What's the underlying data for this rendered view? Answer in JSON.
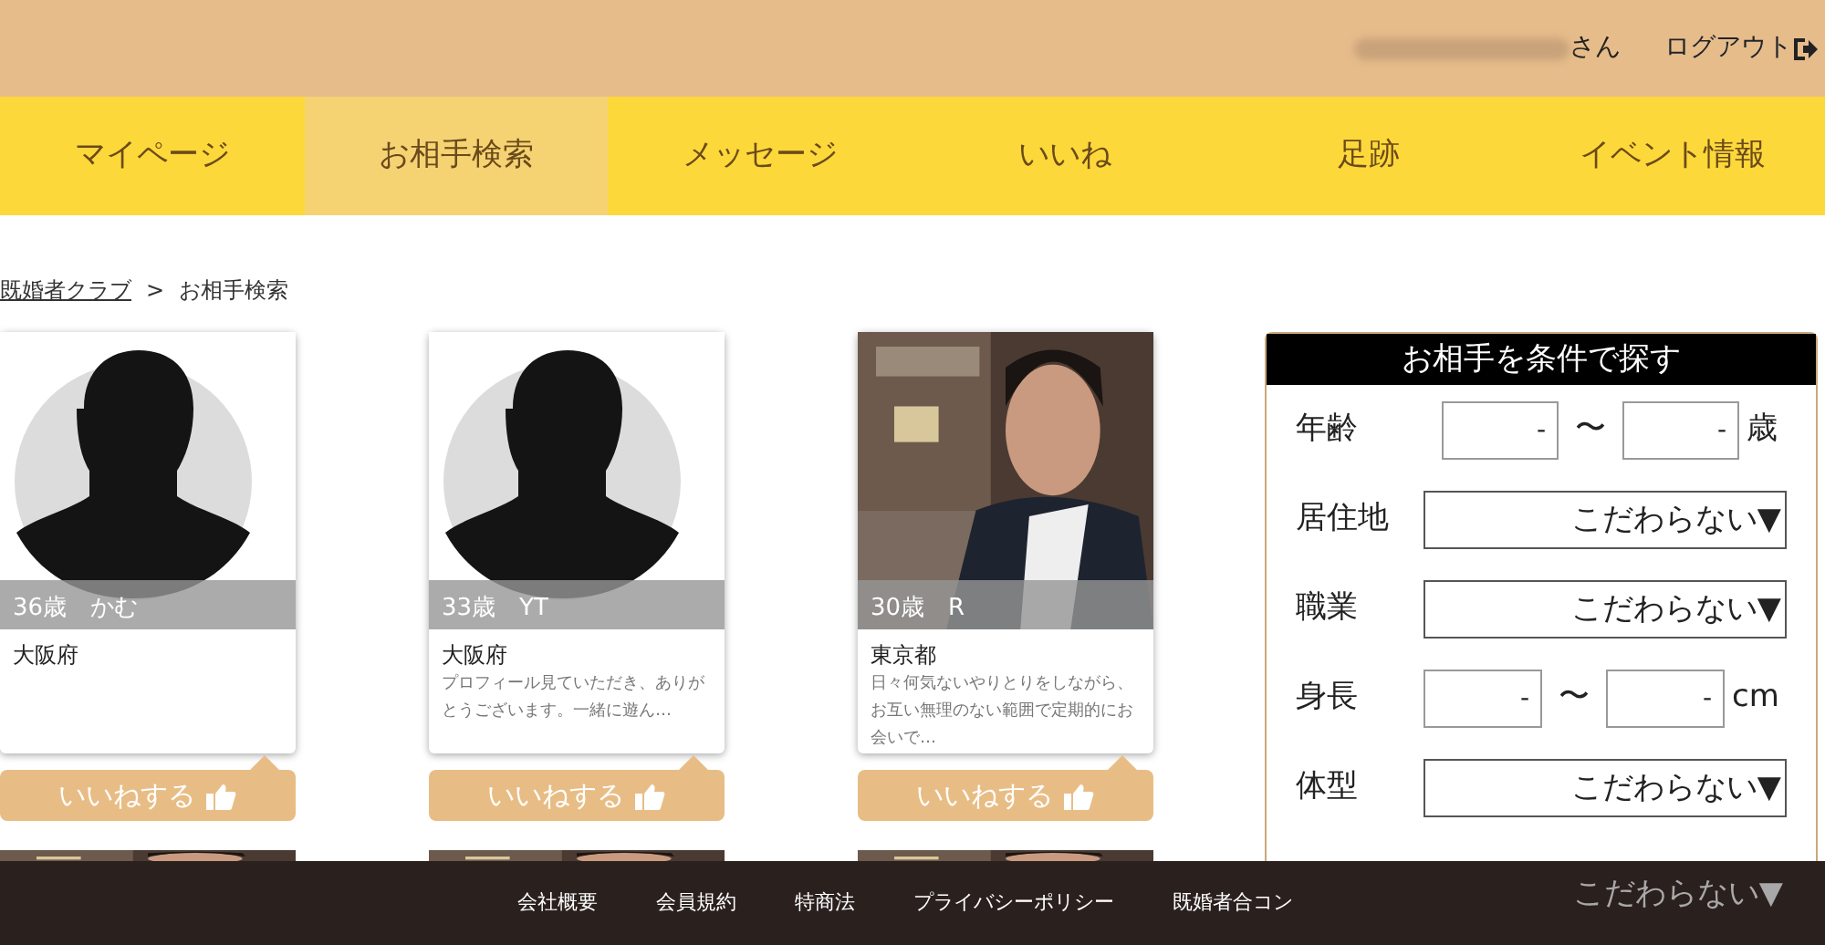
{
  "header": {
    "greeting_suffix": "さん",
    "logout": "ログアウト"
  },
  "nav": [
    {
      "label": "マイページ",
      "selected": false
    },
    {
      "label": "お相手検索",
      "selected": true
    },
    {
      "label": "メッセージ",
      "selected": false
    },
    {
      "label": "いいね",
      "selected": false
    },
    {
      "label": "足跡",
      "selected": false
    },
    {
      "label": "イベント情報",
      "selected": false
    }
  ],
  "breadcrumb": {
    "items": [
      {
        "label": "既婚者クラブ",
        "kind": "link"
      },
      {
        "label": "お相手検索",
        "kind": "current"
      }
    ],
    "separator": ">"
  },
  "cards": [
    {
      "kind": "avatar",
      "caption": "36歳　かむ",
      "location": "大阪府",
      "like": "いいねする"
    },
    {
      "kind": "avatar",
      "caption": "33歳　YT",
      "location": "大阪府",
      "comment": "プロフィール見ていただき、ありがとうございます。一緒に遊ん…",
      "like": "いいねする"
    },
    {
      "kind": "picture",
      "caption": "30歳　R",
      "location": "東京都",
      "comment": "日々何気ないやりとりをしながら、お互い無理のない範囲で定期的にお会いで…",
      "like": "いいねする"
    }
  ],
  "search": {
    "title": "お相手を条件で探す",
    "rows": [
      {
        "kind": "range",
        "label": "年齢",
        "from_placeholder": "-",
        "separator": "〜",
        "to_placeholder": "-",
        "unit": "歳"
      },
      {
        "kind": "select",
        "label": "居住地",
        "value": "こだわらない▼"
      },
      {
        "kind": "select",
        "label": "職業",
        "value": "こだわらない▼"
      },
      {
        "kind": "range",
        "label": "身長",
        "from_placeholder": "-",
        "separator": "〜",
        "to_placeholder": "-",
        "unit": "cm"
      },
      {
        "kind": "select",
        "label": "体型",
        "value": "こだわらない▼"
      },
      {
        "kind": "select_partial",
        "value": "こだわらない▼"
      }
    ]
  },
  "footer": {
    "links": [
      "会社概要",
      "会員規約",
      "特商法",
      "プライバシーポリシー",
      "既婚者合コン"
    ]
  }
}
